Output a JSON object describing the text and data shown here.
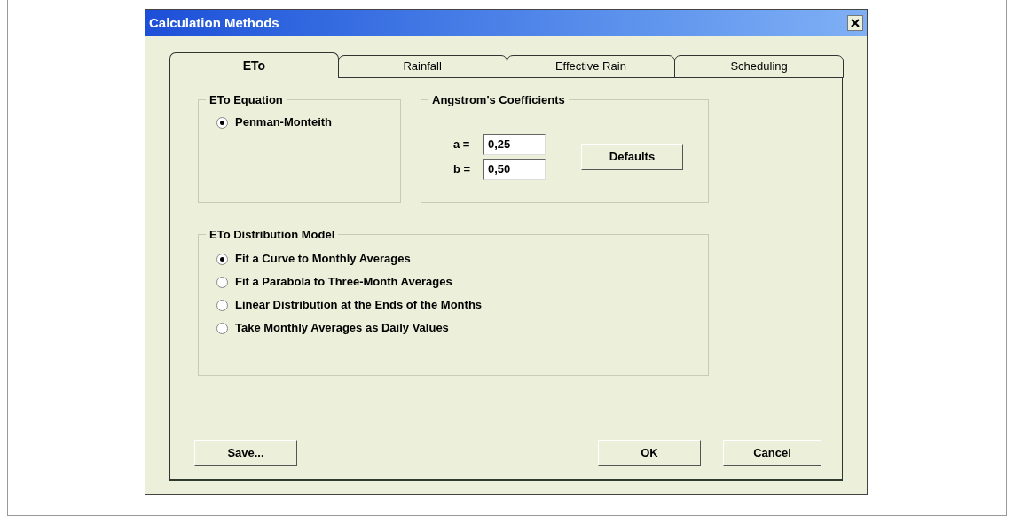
{
  "window": {
    "title": "Calculation Methods"
  },
  "tabs": [
    {
      "label": "ETo",
      "selected": true
    },
    {
      "label": "Rainfall",
      "selected": false
    },
    {
      "label": "Effective Rain",
      "selected": false
    },
    {
      "label": "Scheduling",
      "selected": false
    }
  ],
  "eto_equation": {
    "title": "ETo Equation",
    "options": [
      {
        "label": "Penman-Monteith",
        "selected": true
      }
    ]
  },
  "angstrom": {
    "title": "Angstrom's Coefficients",
    "fields": [
      {
        "label": "a =",
        "value": "0,25"
      },
      {
        "label": "b =",
        "value": "0,50"
      }
    ],
    "button": "Defaults"
  },
  "distribution": {
    "title": "ETo Distribution Model",
    "options": [
      {
        "label": "Fit a Curve to Monthly Averages",
        "selected": true
      },
      {
        "label": "Fit a Parabola to Three-Month Averages",
        "selected": false
      },
      {
        "label": "Linear Distribution at the Ends of the Months",
        "selected": false
      },
      {
        "label": "Take Monthly Averages as Daily Values",
        "selected": false
      }
    ]
  },
  "buttons": [
    "Save...",
    "OK",
    "Cancel"
  ]
}
